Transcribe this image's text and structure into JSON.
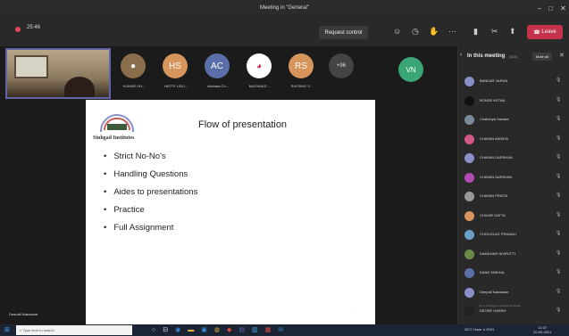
{
  "window": {
    "title": "Meeting in \"General\"",
    "controls": [
      "–",
      "□",
      "✕"
    ]
  },
  "toolbar": {
    "timer": "25:46",
    "request_control": "Request control",
    "leave": "Leave",
    "icons": [
      "participants-icon",
      "chat-icon",
      "reactions-icon",
      "more-icon",
      "camera-icon",
      "mic-icon",
      "share-icon"
    ]
  },
  "participants_strip": [
    {
      "initials": "",
      "name": "KUMAR DH...",
      "color": "#8a6d4a"
    },
    {
      "initials": "HS",
      "name": "HATTE UDO...",
      "color": "#d6955a"
    },
    {
      "initials": "AC",
      "name": "Akshata Ch...",
      "color": "#5a6fa8"
    },
    {
      "initials": "",
      "name": "MAGWALE ...",
      "color": "#ffffff"
    },
    {
      "initials": "RS",
      "name": "RAYSING S...",
      "color": "#d6955a"
    }
  ],
  "more_count": "+96",
  "speaker_initials": "VN",
  "slide": {
    "logo_text": "Sinhgad Institutes",
    "title": "Flow of presentation",
    "bullets": [
      "Strict No-No’s",
      "Handling Questions",
      "Aides to presentations",
      "Practice",
      "Full Assignment"
    ]
  },
  "self_name": "Deepali Nawaskar",
  "panel": {
    "title": "In this meeting",
    "count": "(101)",
    "mute_all": "Mute all",
    "people": [
      {
        "name": "BANKAR VARUN",
        "color": "#8a8fc8"
      },
      {
        "name": "BONDE KETAN",
        "color": "#111111"
      },
      {
        "name": "Chaitanya Sawant",
        "color": "#7a8a9a"
      },
      {
        "name": "CHAVAN ANISHA",
        "color": "#d25a8a"
      },
      {
        "name": "CHAVAN DARSHAN",
        "color": "#8a8fc8"
      },
      {
        "name": "CHAVAN NARAYAN",
        "color": "#b44ab4"
      },
      {
        "name": "CHAVAN PRATIK",
        "color": "#999999"
      },
      {
        "name": "CHILME DATTA",
        "color": "#d6955a"
      },
      {
        "name": "CHOUGULE PRANALI",
        "color": "#6aa0c8"
      },
      {
        "name": "DAMDHAR NIVRUTTI",
        "color": "#6a8a4a"
      },
      {
        "name": "DANE SNEHAL",
        "color": "#5a6fa8"
      },
      {
        "name": "Deepali Nawaskar",
        "color": "#8a8fc8"
      },
      {
        "name": "DEORE HARSH",
        "color": "#222222"
      }
    ]
  },
  "toast": "Go to Settings to activate Windows.",
  "taskbar": {
    "search_placeholder": "Type here to search",
    "tray": "26°C Haze  ∧  ENG",
    "time": "11:07",
    "date": "20-09-2021"
  }
}
